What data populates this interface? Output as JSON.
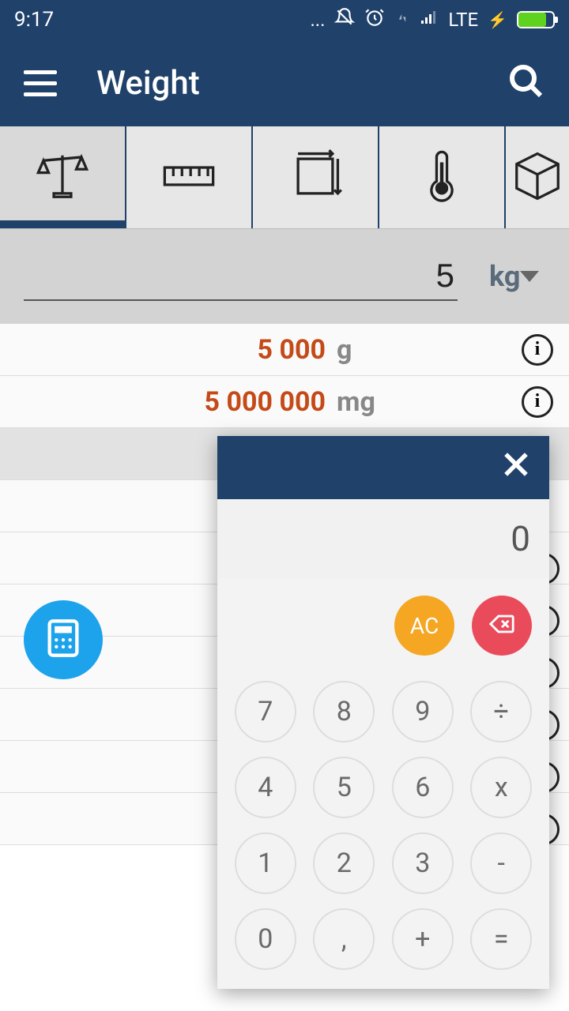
{
  "status": {
    "time": "9:17",
    "network": "LTE"
  },
  "header": {
    "title": "Weight"
  },
  "input": {
    "value": "5",
    "unit": "kg"
  },
  "results": [
    {
      "value": "5 000",
      "unit": "g"
    },
    {
      "value": "5 000 000",
      "unit": "mg"
    }
  ],
  "calculator": {
    "display": "0",
    "ac_label": "AC",
    "keys": [
      "7",
      "8",
      "9",
      "÷",
      "4",
      "5",
      "6",
      "x",
      "1",
      "2",
      "3",
      "-",
      "0",
      ",",
      "+",
      "="
    ]
  }
}
